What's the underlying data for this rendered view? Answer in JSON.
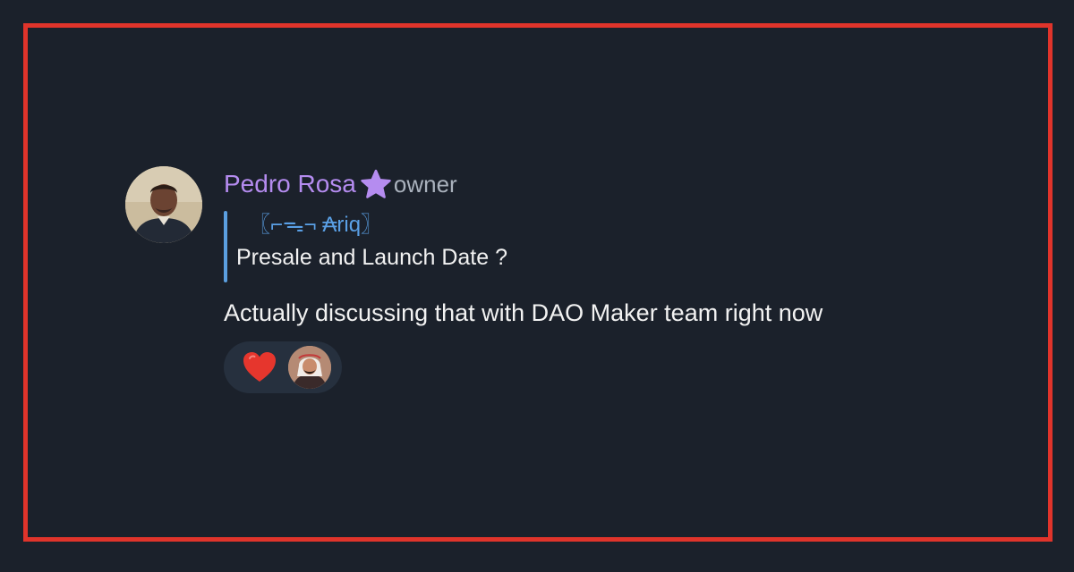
{
  "message": {
    "sender_name": "Pedro Rosa",
    "sender_role": "owner",
    "badge_icon": "star-icon",
    "sender_color": "#b58cf0",
    "reply": {
      "author": "〖⌐ᯓ¬ ₳riq〗",
      "author_color": "#5aa0e6",
      "text": "Presale and Launch Date ?"
    },
    "text": "Actually discussing that with DAO Maker team right now",
    "reactions": [
      {
        "icon": "heart-icon",
        "color": "#e6362d"
      }
    ],
    "reactor_avatar": "reactor-avatar"
  },
  "colors": {
    "background": "#1b212b",
    "frame_border": "#e0342b",
    "reply_bar": "#5b9fe0"
  }
}
